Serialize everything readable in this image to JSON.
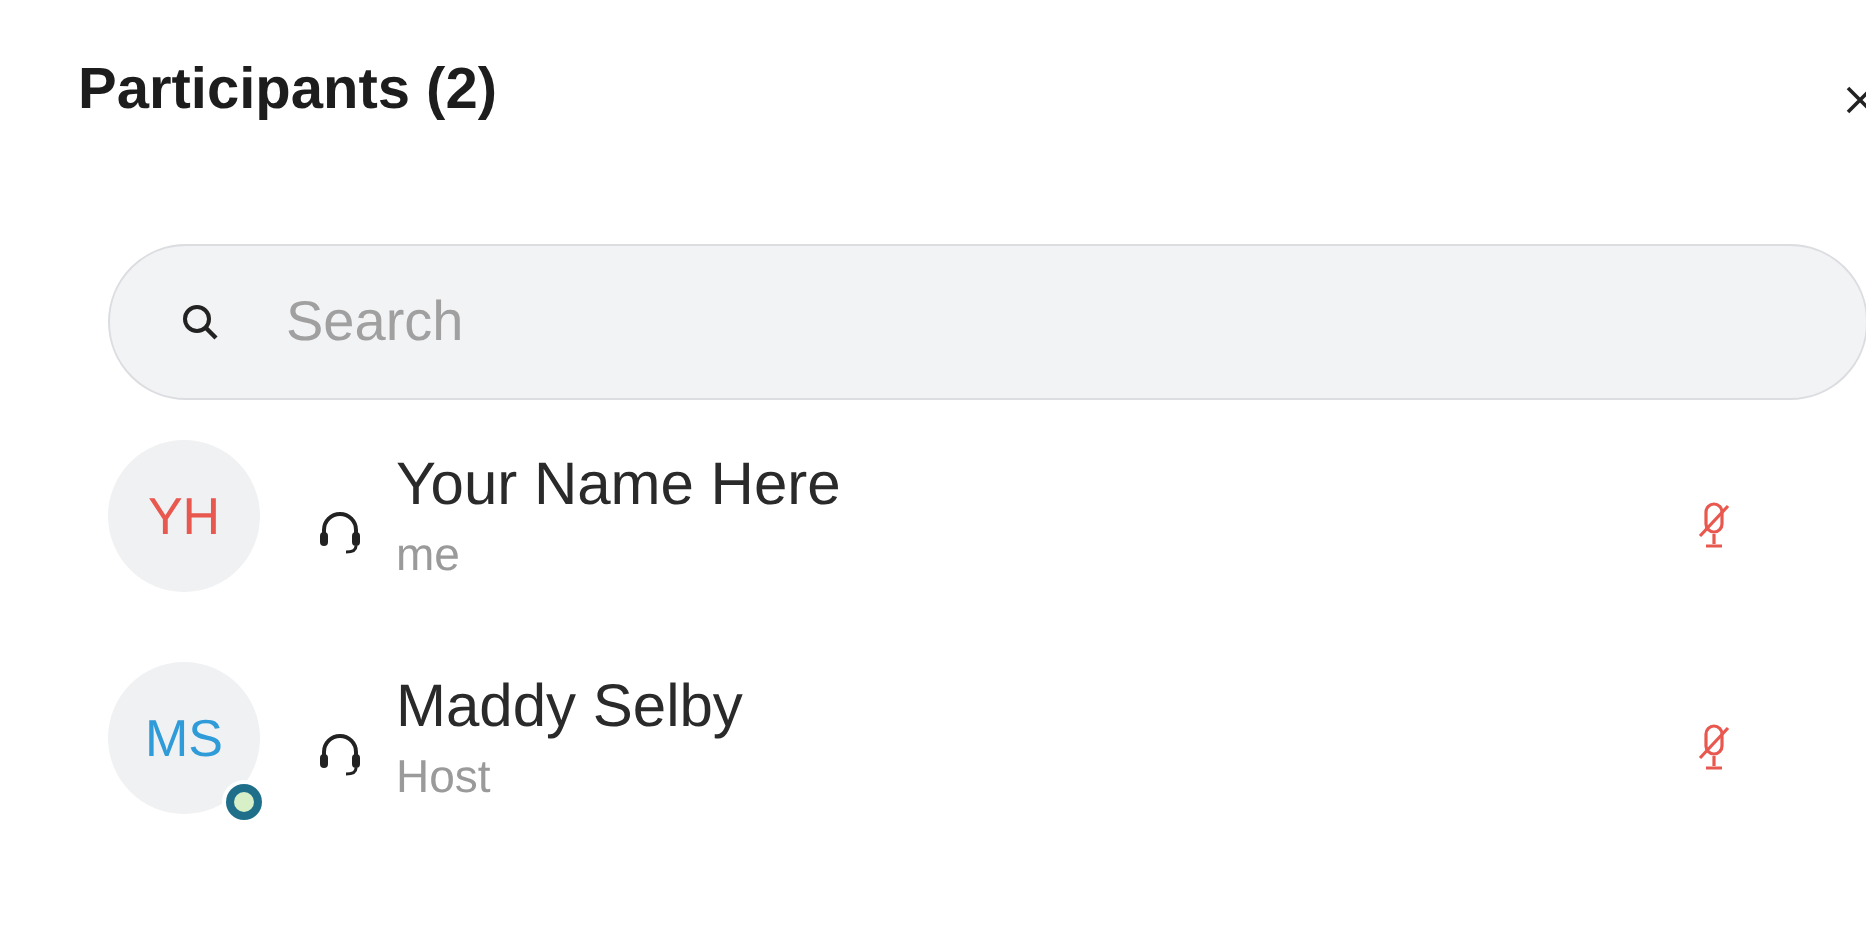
{
  "panel": {
    "title": "Participants (2)"
  },
  "search": {
    "placeholder": "Search"
  },
  "participants": [
    {
      "initials": "YH",
      "color": "#e8584f",
      "name": "Your Name Here",
      "role": "me",
      "muted": true,
      "badge": false
    },
    {
      "initials": "MS",
      "color": "#2f9bd8",
      "name": "Maddy Selby",
      "role": "Host",
      "muted": true,
      "badge": true
    }
  ]
}
